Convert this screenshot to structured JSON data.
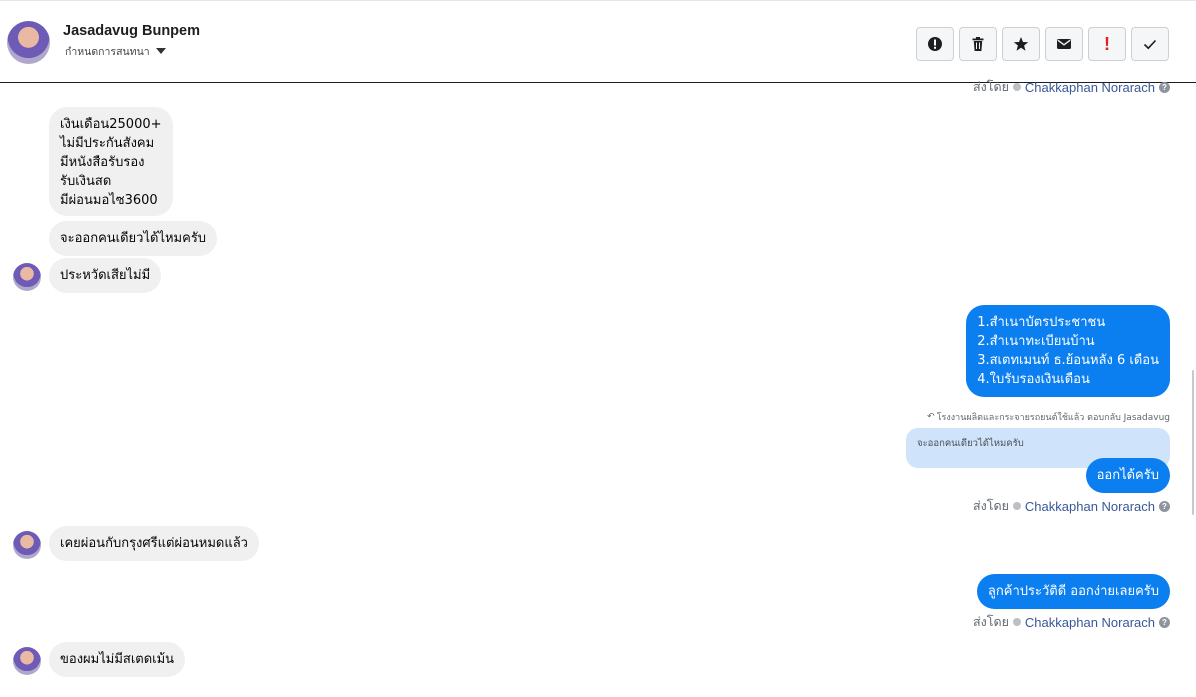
{
  "header": {
    "contact_name": "Jasadavug Bunpem",
    "contact_subtitle": "กำหนดการสนทนา",
    "toolbar": [
      {
        "name": "alert-button",
        "icon": "exclamation-circle-icon"
      },
      {
        "name": "delete-button",
        "icon": "trash-icon"
      },
      {
        "name": "star-button",
        "icon": "star-icon"
      },
      {
        "name": "mail-button",
        "icon": "envelope-icon"
      },
      {
        "name": "mark-important-button",
        "icon": "exclamation-icon"
      },
      {
        "name": "done-button",
        "icon": "check-icon"
      }
    ]
  },
  "sent_by_prefix": "ส่งโดย",
  "agent_name": "Chakkaphan Norarach",
  "messages": {
    "m1": [
      "เงินเดือน25000+",
      "ไม่มีประกันสังคม",
      "มีหนังสือรับรอง",
      "รับเงินสด",
      "มีผ่อนมอไซ3600"
    ],
    "m2": "จะออกคนเดียวได้ไหมครับ",
    "m3": "ประหวัดเสียไม่มี",
    "m4": [
      "1.สำเนาบัตรประชาชน",
      "2.สำเนาทะเบียนบ้าน",
      "3.สเตทเมนท์ ธ.ย้อนหลัง 6 เดือน",
      "4.ใบรับรองเงินเดือน"
    ],
    "reply_note": "โรงงานผลิตและกระจายรถยนต์ใช้แล้ว ตอบกลับ Jasadavug",
    "quoted_text": "จะออกคนเดียวได้ไหมครับ",
    "m5": "ออกได้ครับ",
    "m6": "เคยผ่อนกับกรุงศรีแต่ผ่อนหมดแล้ว",
    "m7": "ลูกค้าประวัติดี ออกง่ายเลยครับ",
    "m8": "ของผมไม่มีสเตดเม้น"
  },
  "colors": {
    "outgoing_bubble": "#0b7ff0",
    "incoming_bubble": "#f0f0f0",
    "quoted_bubble": "#cfe3fb",
    "agent_link": "#385898"
  }
}
